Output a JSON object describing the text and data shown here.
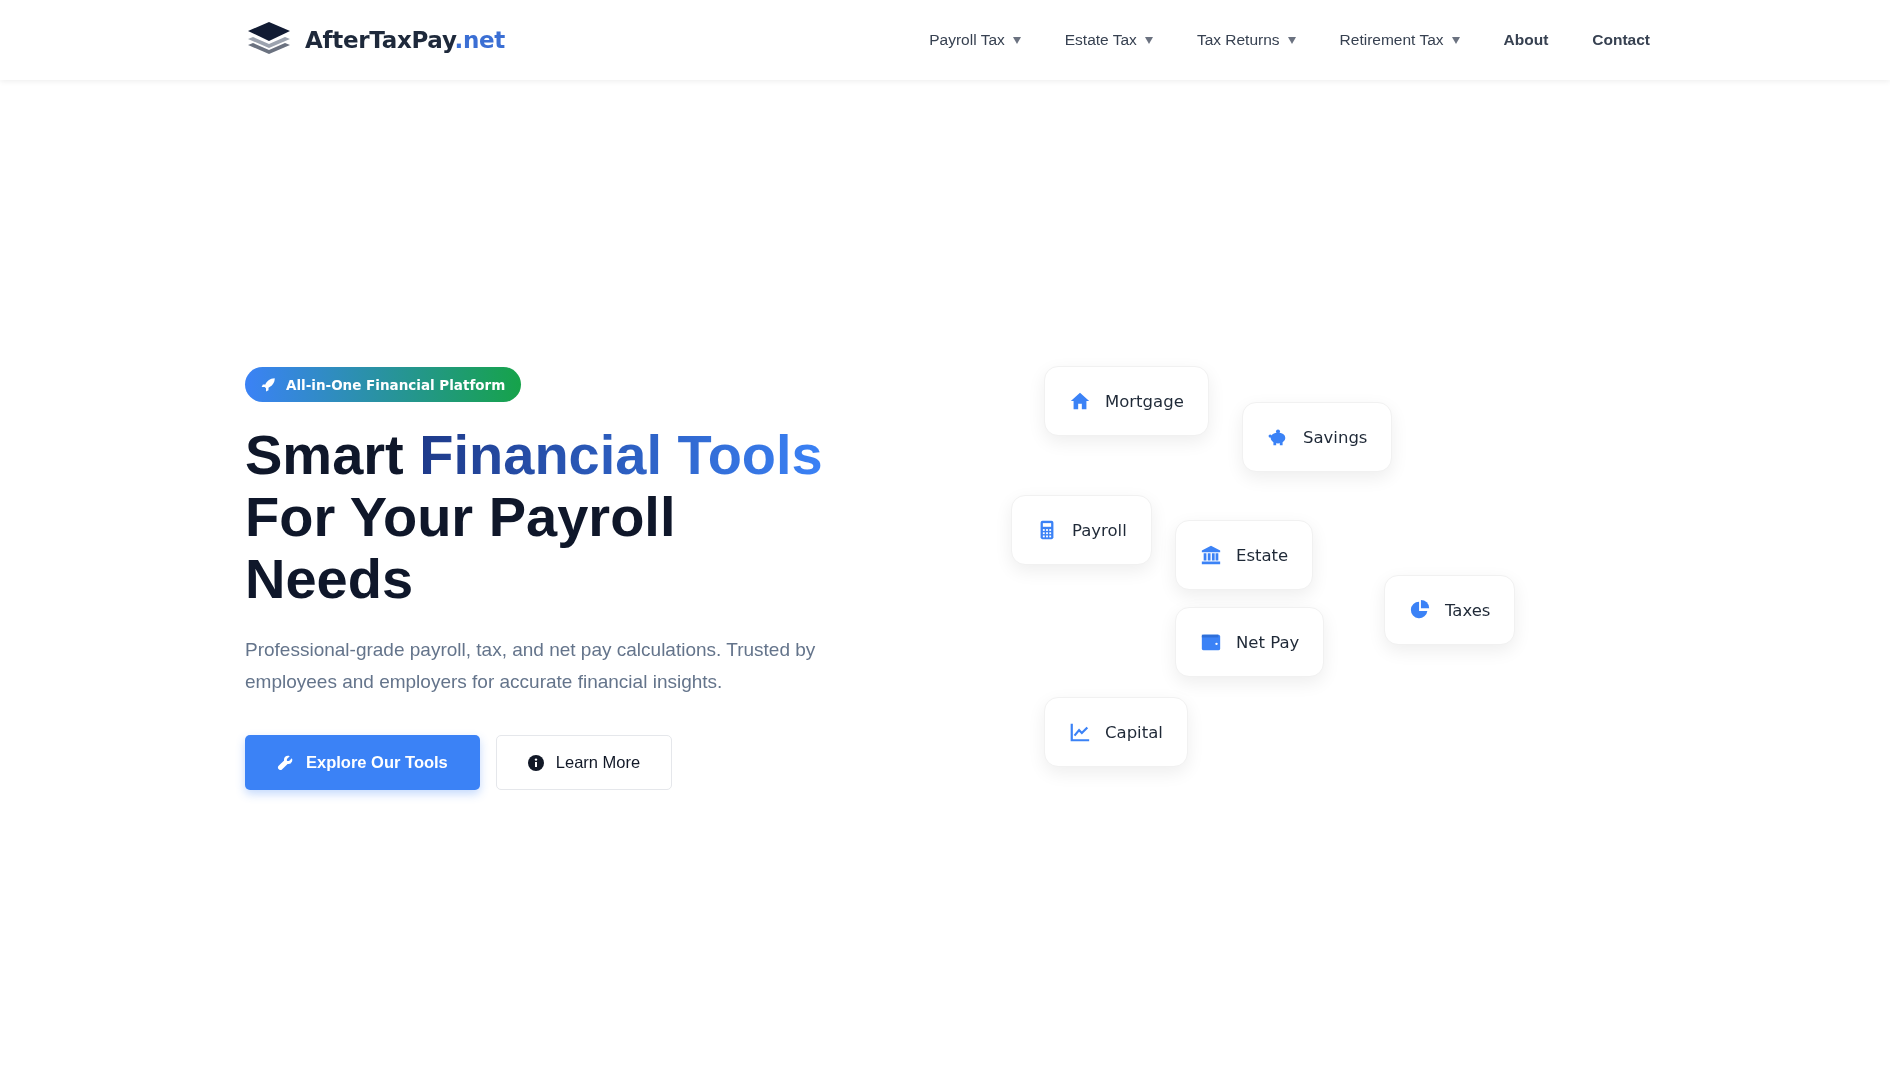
{
  "header": {
    "logo": {
      "brand": "AfterTaxPay",
      "suffix": ".net"
    },
    "nav": [
      {
        "label": "Payroll Tax",
        "dropdown": true
      },
      {
        "label": "Estate Tax",
        "dropdown": true
      },
      {
        "label": "Tax Returns",
        "dropdown": true
      },
      {
        "label": "Retirement Tax",
        "dropdown": true
      },
      {
        "label": "About",
        "dropdown": false
      },
      {
        "label": "Contact",
        "dropdown": false
      }
    ]
  },
  "hero": {
    "badge": "All-in-One Financial Platform",
    "heading": [
      {
        "text": "Smart ",
        "highlight": false
      },
      {
        "text": "Financial Tools",
        "highlight": true
      },
      {
        "text": " For Your Payroll Needs",
        "highlight": false
      }
    ],
    "description": "Professional-grade payroll, tax, and net pay calculations. Trusted by employees and employers for accurate financial insights.",
    "buttons": [
      {
        "label": "Explore Our Tools",
        "kind": "primary"
      },
      {
        "label": "Learn More",
        "kind": "secondary"
      }
    ]
  },
  "tool_cards": [
    {
      "label": "Mortgage"
    },
    {
      "label": "Savings"
    },
    {
      "label": "Payroll"
    },
    {
      "label": "Estate"
    },
    {
      "label": "Taxes"
    },
    {
      "label": "Net Pay"
    },
    {
      "label": "Capital"
    }
  ]
}
